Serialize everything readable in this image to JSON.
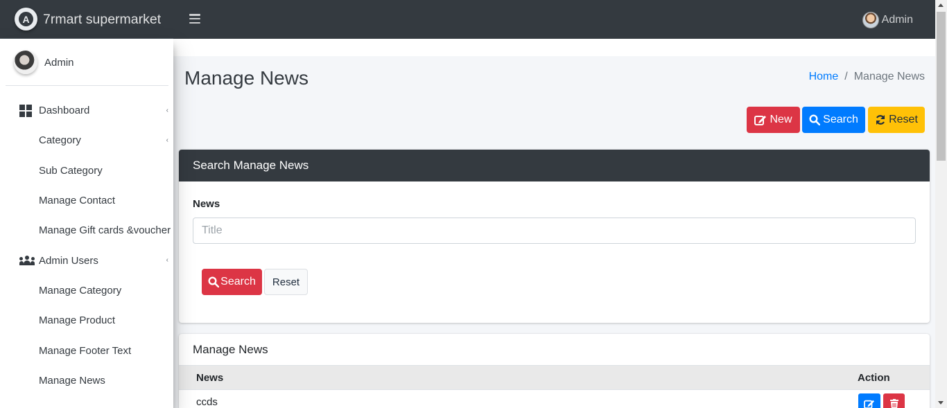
{
  "app": {
    "brand_name": "7rmart supermarket",
    "top_user": "Admin"
  },
  "sidebar": {
    "user_name": "Admin",
    "items": [
      {
        "label": "Dashboard",
        "icon": "dashboard-icon",
        "has_caret": true
      },
      {
        "label": "Category",
        "has_caret": true
      },
      {
        "label": "Sub Category"
      },
      {
        "label": "Manage Contact"
      },
      {
        "label": "Manage Gift cards &voucher"
      },
      {
        "label": "Admin Users",
        "icon": "users-icon",
        "has_caret": true
      },
      {
        "label": "Manage Category"
      },
      {
        "label": "Manage Product"
      },
      {
        "label": "Manage Footer Text"
      },
      {
        "label": "Manage News"
      }
    ]
  },
  "header": {
    "page_title": "Manage News",
    "breadcrumb": {
      "home": "Home",
      "current": "Manage News"
    }
  },
  "toolbar": {
    "new_label": "New",
    "search_label": "Search",
    "reset_label": "Reset"
  },
  "search_card": {
    "title": "Search Manage News",
    "field_label": "News",
    "field_placeholder": "Title",
    "field_value": "",
    "search_button": "Search",
    "reset_button": "Reset"
  },
  "list_card": {
    "title": "Manage News",
    "columns": [
      "News",
      "Action"
    ],
    "rows": [
      {
        "news": "ccds"
      }
    ]
  },
  "colors": {
    "navbar": "#343a40",
    "danger": "#dc3545",
    "primary": "#007bff",
    "warning": "#ffc107"
  }
}
